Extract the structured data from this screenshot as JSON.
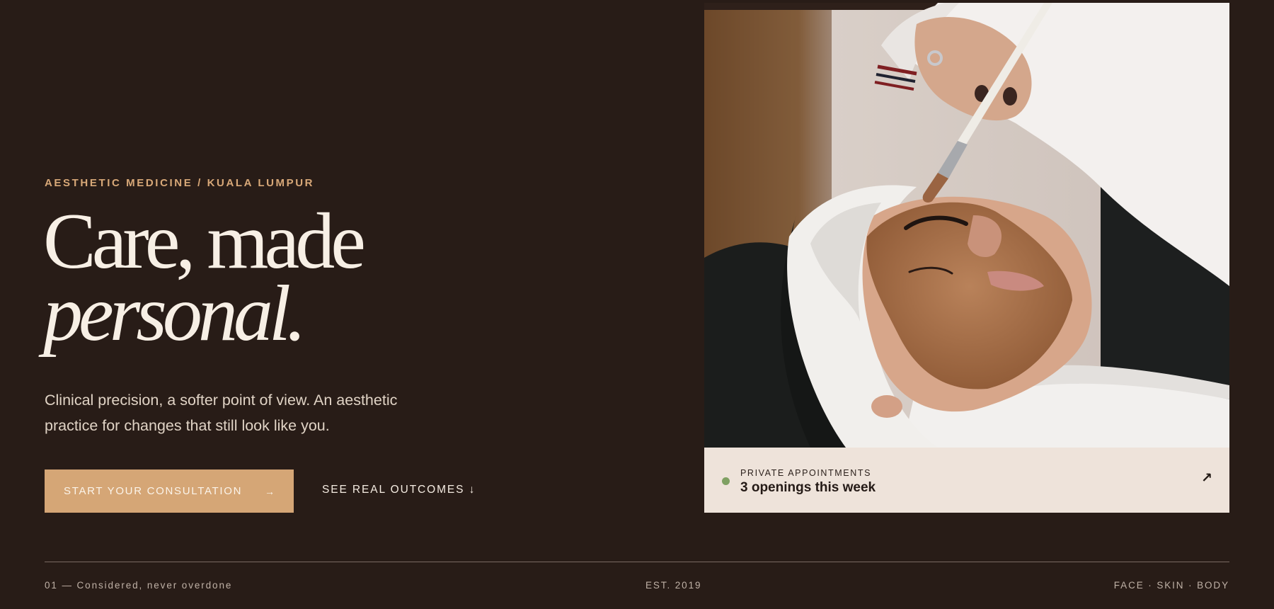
{
  "hero": {
    "eyebrow": "AESTHETIC MEDICINE / KUALA LUMPUR",
    "headline_line1": "Care, made",
    "headline_line2": "personal.",
    "lede": "Clinical precision, a softer point of view. An aesthetic practice for changes that still look like you.",
    "cta_primary_label": "START YOUR CONSULTATION",
    "cta_primary_arrow": "→",
    "cta_secondary_label": "SEE REAL OUTCOMES ↓"
  },
  "media": {
    "photo_icon": "facial-treatment-photo",
    "appointments": {
      "label": "PRIVATE APPOINTMENTS",
      "value": "3 openings this week",
      "arrow": "↗",
      "status_color": "#7fa062"
    }
  },
  "footer": {
    "left": "01 — Considered, never overdone",
    "center": "EST. 2019",
    "right": "FACE · SKIN · BODY"
  },
  "colors": {
    "background": "#281c17",
    "accent": "#d5a676",
    "eyebrow": "#d8a878",
    "headline": "#f7efe5",
    "card": "#eee3da"
  }
}
